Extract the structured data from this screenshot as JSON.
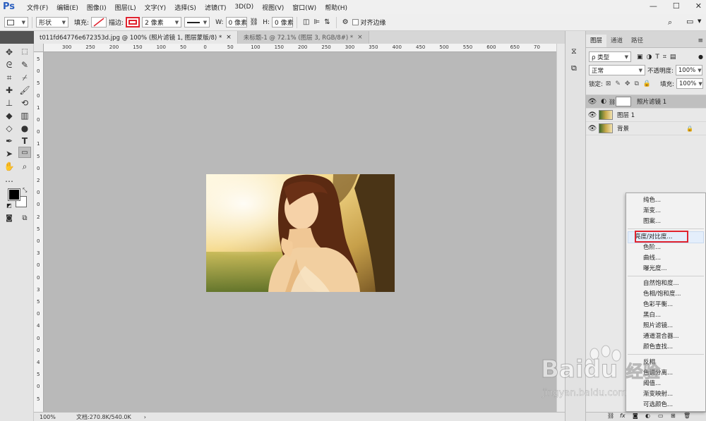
{
  "app": {
    "logo": "Ps"
  },
  "menu": [
    "文件(F)",
    "编辑(E)",
    "图像(I)",
    "图层(L)",
    "文字(Y)",
    "选择(S)",
    "滤镜(T)",
    "3D(D)",
    "视图(V)",
    "窗口(W)",
    "帮助(H)"
  ],
  "options": {
    "mode": "形状",
    "fill_label": "填充:",
    "stroke_label": "描边:",
    "stroke_size": "2 像素",
    "w_label": "W:",
    "w_value": "0 像素",
    "h_label": "H:",
    "h_value": "0 像素",
    "align_edges": "对齐边缘",
    "align_edges_checked": false
  },
  "tabs": [
    {
      "label": "t011fd64776e672353d.jpg @ 100% (照片滤镜 1, 图层蒙版/8) *",
      "active": true
    },
    {
      "label": "未标题-1 @ 72.1% (图层 3, RGB/8#) *",
      "active": false
    }
  ],
  "ruler": {
    "h_ticks": [
      "300",
      "250",
      "200",
      "150",
      "100",
      "50",
      "0",
      "50",
      "100",
      "150",
      "200",
      "250",
      "300",
      "350",
      "400",
      "450",
      "500",
      "550",
      "600",
      "650",
      "70"
    ],
    "v_ticks": [
      "5",
      "0",
      "5",
      "0",
      "1",
      "0",
      "0",
      "1",
      "5",
      "0",
      "2",
      "0",
      "0",
      "2",
      "5",
      "0",
      "3",
      "0",
      "0",
      "3",
      "5",
      "0",
      "4",
      "0",
      "0",
      "4",
      "5",
      "0",
      "5"
    ]
  },
  "status": {
    "zoom": "100%",
    "doc": "文档:270.8K/540.0K"
  },
  "panel": {
    "tabs": [
      "图层",
      "通道",
      "路径"
    ],
    "kind_label": "ρ 类型",
    "blend_mode": "正常",
    "opacity_label": "不透明度:",
    "opacity_value": "100%",
    "lock_label": "锁定:",
    "fill_label": "填充:",
    "fill_value": "100%",
    "layers": [
      {
        "name": "照片滤镜 1",
        "selected": true,
        "type": "adjustment"
      },
      {
        "name": "图层 1",
        "selected": false,
        "type": "image"
      },
      {
        "name": "背景",
        "selected": false,
        "type": "background",
        "locked": true
      }
    ]
  },
  "adjust_menu": {
    "groups": [
      [
        "纯色...",
        "渐变...",
        "图案..."
      ],
      [
        "亮度/对比度...",
        "色阶...",
        "曲线...",
        "曝光度..."
      ],
      [
        "自然饱和度...",
        "色相/饱和度...",
        "色彩平衡...",
        "黑白...",
        "照片滤镜...",
        "通道混合器...",
        "颜色查找..."
      ],
      [
        "反相",
        "色调分离...",
        "阈值...",
        "渐变映射...",
        "可选颜色..."
      ]
    ],
    "highlighted": "亮度/对比度..."
  },
  "watermark": {
    "brand": "Baidu",
    "brand_cn": "经验",
    "url": "jingyan.baidu.com"
  },
  "colors": {
    "accent_red": "#e0232e",
    "canvas_bg": "#b9b9b9",
    "selection_blue": "#e4eefb"
  }
}
